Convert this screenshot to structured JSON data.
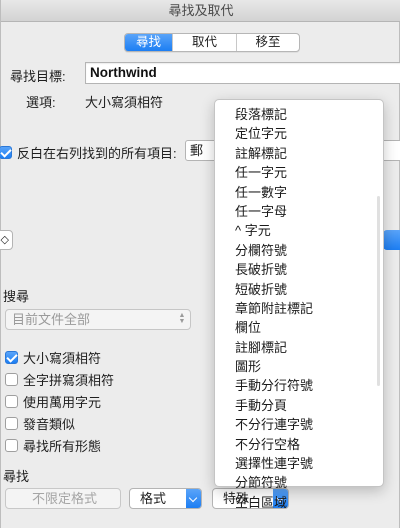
{
  "window": {
    "title": "尋找及取代"
  },
  "tabs": [
    {
      "label": "尋找",
      "active": true
    },
    {
      "label": "取代",
      "active": false
    },
    {
      "label": "移至",
      "active": false
    }
  ],
  "find": {
    "label": "尋找目標:",
    "value": "Northwind"
  },
  "options": {
    "label": "選項:",
    "value": "大小寫須相符"
  },
  "highlight": {
    "label": "反白在右列找到的所有項目:",
    "checked": true,
    "select_value": "郵"
  },
  "left_button_glyph": "◇",
  "search": {
    "label": "搜尋",
    "scope": "目前文件全部"
  },
  "checkboxes": [
    {
      "label": "大小寫須相符",
      "checked": true
    },
    {
      "label": "全字拼寫須相符",
      "checked": false
    },
    {
      "label": "使用萬用字元",
      "checked": false
    },
    {
      "label": "發音類似",
      "checked": false
    },
    {
      "label": "尋找所有形態",
      "checked": false
    }
  ],
  "replace_section": {
    "label": "尋找",
    "no_format": "不限定格式",
    "format": "格式",
    "special": "特殊"
  },
  "special_menu": [
    "段落標記",
    "定位字元",
    "註解標記",
    "任一字元",
    "任一數字",
    "任一字母",
    "^ 字元",
    "分欄符號",
    "長破折號",
    "短破折號",
    "章節附註標記",
    "欄位",
    "註腳標記",
    "圖形",
    "手動分行符號",
    "手動分頁",
    "不分行連字號",
    "不分行空格",
    "選擇性連字號",
    "分節符號",
    "空白區域"
  ],
  "colors": {
    "accent": "#1c7ef3",
    "background": "#ececec"
  }
}
